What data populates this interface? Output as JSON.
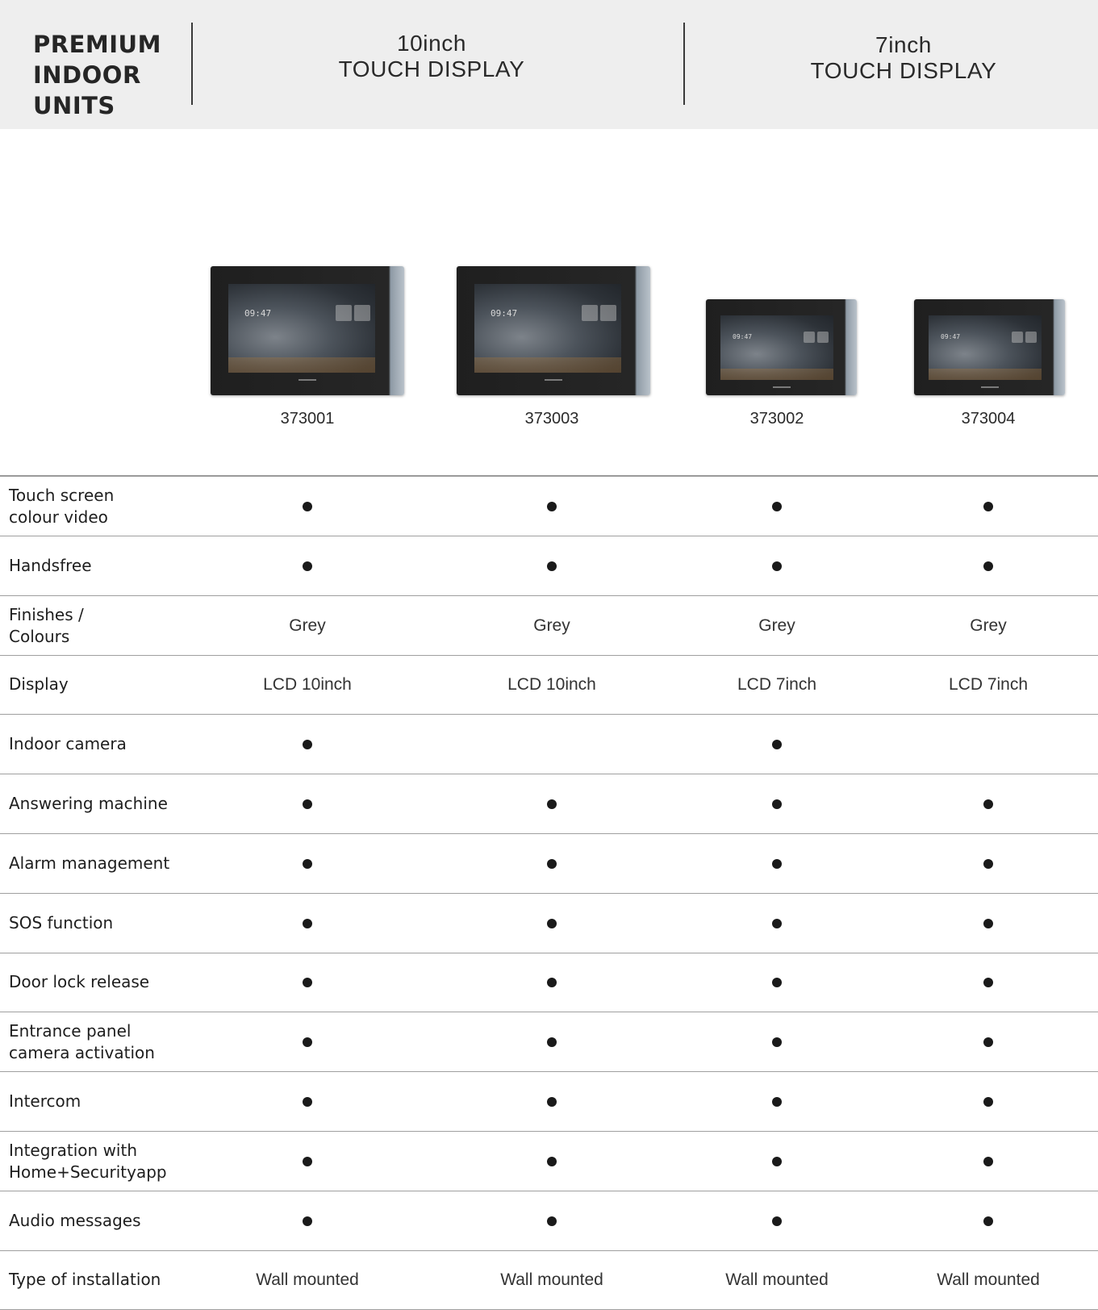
{
  "header": {
    "brand_lines": [
      "PREMIUM",
      "INDOOR",
      "UNITS"
    ],
    "groups": [
      {
        "line1": "10inch",
        "line2": "TOUCH DISPLAY"
      },
      {
        "line1": "7inch",
        "line2": "TOUCH DISPLAY"
      }
    ]
  },
  "products": [
    {
      "code": "373001",
      "size": "10inch"
    },
    {
      "code": "373003",
      "size": "10inch"
    },
    {
      "code": "373002",
      "size": "7inch"
    },
    {
      "code": "373004",
      "size": "7inch"
    }
  ],
  "device_screen": {
    "clock_text": "09:47"
  },
  "features": [
    {
      "label": "Touch screen\ncolour video",
      "values": [
        "dot",
        "dot",
        "dot",
        "dot"
      ]
    },
    {
      "label": "Handsfree",
      "values": [
        "dot",
        "dot",
        "dot",
        "dot"
      ]
    },
    {
      "label": "Finishes /\nColours",
      "values": [
        "Grey",
        "Grey",
        "Grey",
        "Grey"
      ]
    },
    {
      "label": "Display",
      "values": [
        "LCD 10inch",
        "LCD 10inch",
        "LCD 7inch",
        "LCD 7inch"
      ]
    },
    {
      "label": "Indoor camera",
      "values": [
        "dot",
        "",
        "dot",
        ""
      ]
    },
    {
      "label": "Answering machine",
      "values": [
        "dot",
        "dot",
        "dot",
        "dot"
      ]
    },
    {
      "label": "Alarm management",
      "values": [
        "dot",
        "dot",
        "dot",
        "dot"
      ]
    },
    {
      "label": "SOS function",
      "values": [
        "dot",
        "dot",
        "dot",
        "dot"
      ]
    },
    {
      "label": "Door lock release",
      "values": [
        "dot",
        "dot",
        "dot",
        "dot"
      ]
    },
    {
      "label": "Entrance panel\ncamera activation",
      "values": [
        "dot",
        "dot",
        "dot",
        "dot"
      ]
    },
    {
      "label": "Intercom",
      "values": [
        "dot",
        "dot",
        "dot",
        "dot"
      ]
    },
    {
      "label": "Integration with\nHome+Securityapp",
      "values": [
        "dot",
        "dot",
        "dot",
        "dot"
      ]
    },
    {
      "label": "Audio messages",
      "values": [
        "dot",
        "dot",
        "dot",
        "dot"
      ]
    },
    {
      "label": "Type of installation",
      "values": [
        "Wall mounted",
        "Wall mounted",
        "Wall mounted",
        "Wall mounted"
      ]
    }
  ]
}
